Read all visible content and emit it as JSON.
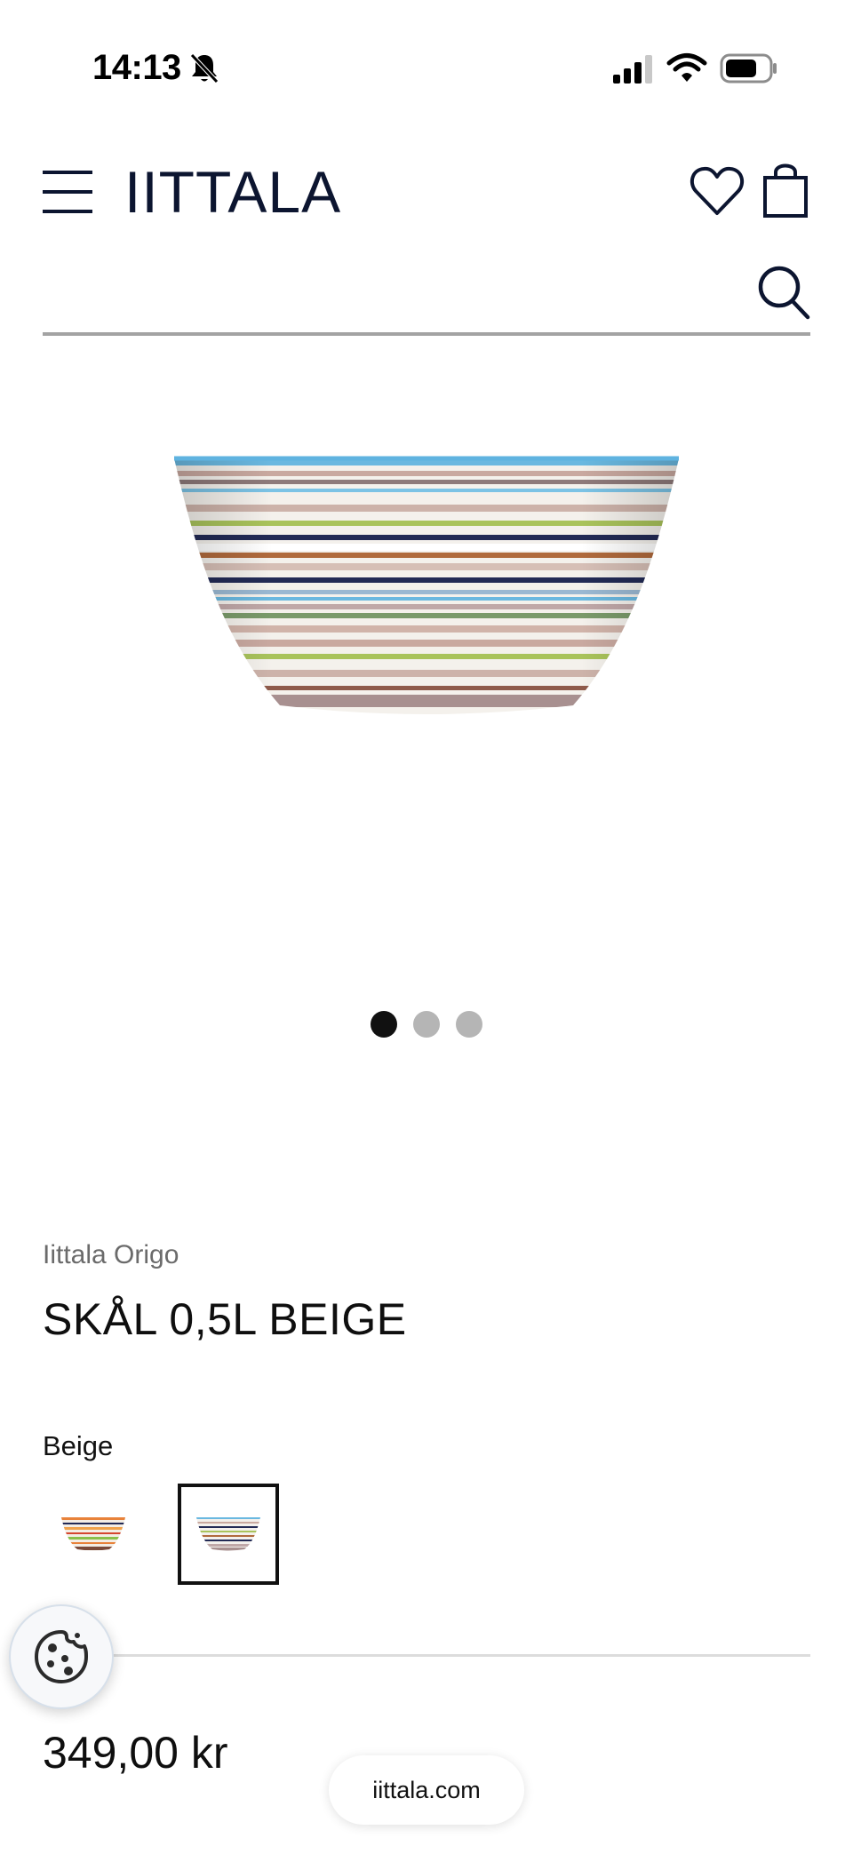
{
  "status_bar": {
    "time": "14:13",
    "icons": [
      "bell-slash-icon",
      "cellular-signal-icon",
      "wifi-icon",
      "battery-icon"
    ]
  },
  "header": {
    "logo": "IITTALA",
    "icons": [
      "hamburger-menu-icon",
      "heart-icon",
      "shopping-bag-icon"
    ]
  },
  "search": {
    "value": "",
    "placeholder": "",
    "icon": "search-icon"
  },
  "gallery": {
    "image": "striped-bowl",
    "slide_count": 3,
    "active_index": 0
  },
  "product": {
    "brand": "Iittala Origo",
    "title": "SKÅL 0,5L BEIGE",
    "color_label": "Beige",
    "swatches": [
      {
        "name": "orange",
        "selected": false
      },
      {
        "name": "beige",
        "selected": true
      }
    ],
    "price": "349,00 kr"
  },
  "browser": {
    "url": "iittala.com"
  },
  "colors": {
    "brand_navy": "#0c1530",
    "divider": "#dcdcdc",
    "dot_active": "#111111",
    "dot_inactive": "#b5b5b5"
  }
}
